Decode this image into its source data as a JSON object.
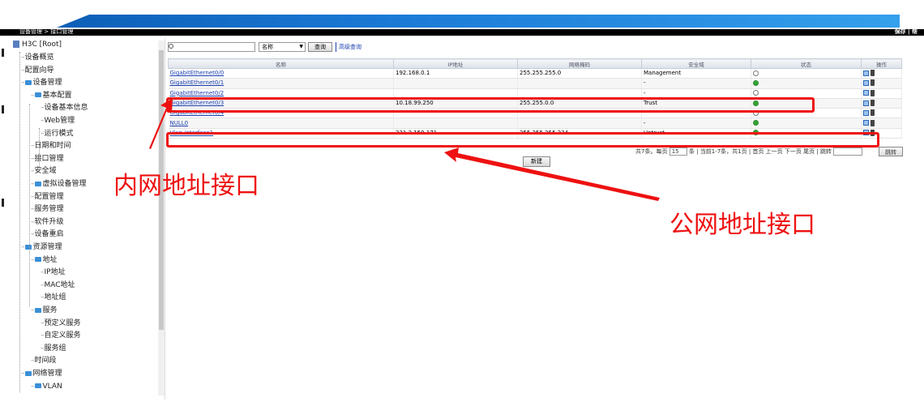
{
  "header": {
    "breadcrumb": "设备管理 > 接口管理",
    "save_label": "保存 | 帮"
  },
  "sidebar": {
    "root": "H3C [Root]",
    "items": [
      {
        "label": "设备概览",
        "level": 1,
        "folder": false
      },
      {
        "label": "配置向导",
        "level": 1,
        "folder": false
      },
      {
        "label": "设备管理",
        "level": 1,
        "folder": true
      },
      {
        "label": "基本配置",
        "level": 2,
        "folder": true
      },
      {
        "label": "设备基本信息",
        "level": 3,
        "folder": false
      },
      {
        "label": "Web管理",
        "level": 3,
        "folder": false
      },
      {
        "label": "运行模式",
        "level": 3,
        "folder": false
      },
      {
        "label": "日期和时间",
        "level": 2,
        "folder": false
      },
      {
        "label": "接口管理",
        "level": 2,
        "folder": false
      },
      {
        "label": "安全域",
        "level": 2,
        "folder": false
      },
      {
        "label": "虚拟设备管理",
        "level": 2,
        "folder": true
      },
      {
        "label": "配置管理",
        "level": 2,
        "folder": false
      },
      {
        "label": "服务管理",
        "level": 2,
        "folder": false
      },
      {
        "label": "软件升级",
        "level": 2,
        "folder": false
      },
      {
        "label": "设备重启",
        "level": 2,
        "folder": false
      },
      {
        "label": "资源管理",
        "level": 1,
        "folder": true
      },
      {
        "label": "地址",
        "level": 2,
        "folder": true
      },
      {
        "label": "IP地址",
        "level": 3,
        "folder": false
      },
      {
        "label": "MAC地址",
        "level": 3,
        "folder": false
      },
      {
        "label": "地址组",
        "level": 3,
        "folder": false
      },
      {
        "label": "服务",
        "level": 2,
        "folder": true
      },
      {
        "label": "预定义服务",
        "level": 3,
        "folder": false
      },
      {
        "label": "自定义服务",
        "level": 3,
        "folder": false
      },
      {
        "label": "服务组",
        "level": 3,
        "folder": false
      },
      {
        "label": "时间段",
        "level": 2,
        "folder": false
      },
      {
        "label": "网络管理",
        "level": 1,
        "folder": true
      },
      {
        "label": "VLAN",
        "level": 2,
        "folder": true
      }
    ]
  },
  "search": {
    "placeholder": "",
    "field_value": "名称",
    "query_label": "查询",
    "advanced_label": "高级查询"
  },
  "table": {
    "columns": [
      "名称",
      "IP地址",
      "网络掩码",
      "安全域",
      "状态",
      "操作"
    ],
    "rows": [
      {
        "name": "GigabitEthernet0/0",
        "ip": "192.168.0.1",
        "mask": "255.255.255.0",
        "zone": "Management",
        "status": "down"
      },
      {
        "name": "GigabitEthernet0/1",
        "ip": "",
        "mask": "",
        "zone": "-",
        "status": "up"
      },
      {
        "name": "GigabitEthernet0/2",
        "ip": "",
        "mask": "",
        "zone": "-",
        "status": "down"
      },
      {
        "name": "GigabitEthernet0/3",
        "ip": "10.18.99.250",
        "mask": "255.255.0.0",
        "zone": "Trust",
        "status": "up"
      },
      {
        "name": "GigabitEthernet0/4",
        "ip": "",
        "mask": "",
        "zone": "-",
        "status": "down"
      },
      {
        "name": "NULL0",
        "ip": "",
        "mask": "",
        "zone": "-",
        "status": "up"
      },
      {
        "name": "Vlan-interface1",
        "ip": "221.2.159.171",
        "mask": "255.255.255.224",
        "zone": "Untrust",
        "status": "up"
      }
    ]
  },
  "pager": {
    "text": "共7条。每页",
    "page_size": "15",
    "rest": "条 | 当前1-7条，共1页 | 首页 上一页 下一页 尾页 | 跳转",
    "goto_label": "跳转"
  },
  "new_button": "新建",
  "annotations": {
    "intranet": "内网地址接口",
    "public": "公网地址接口",
    "color": "#ee1111"
  }
}
